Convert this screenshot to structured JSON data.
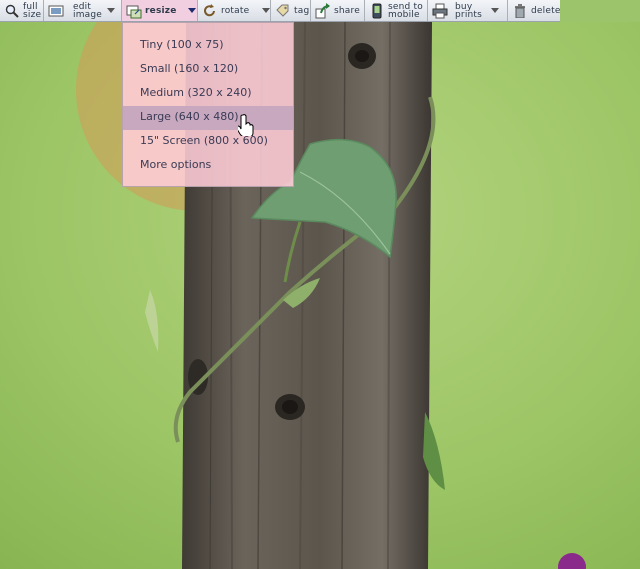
{
  "toolbar": {
    "full_size": [
      "full",
      "size"
    ],
    "edit_image": [
      "edit",
      "image"
    ],
    "resize": "resize",
    "rotate": "rotate",
    "tag": "tag",
    "share": "share",
    "send_to_mobile": [
      "send to",
      "mobile"
    ],
    "buy_prints": [
      "buy",
      "prints"
    ],
    "delete": "delete"
  },
  "resize_menu": {
    "items": [
      "Tiny (100 x 75)",
      "Small (160 x 120)",
      "Medium (320 x 240)",
      "Large (640 x 480)",
      "15\" Screen (800 x 600)",
      "More options"
    ],
    "highlighted": "Large (640 x 480)"
  },
  "colors": {
    "toolbar_bg": "#dfe3e9",
    "menu_bg": "#ffcdd7",
    "menu_highlight": "#c7a8bf",
    "active_tab": "#f2cfe0"
  },
  "icons": [
    "magnifier-icon",
    "edit-image-icon",
    "resize-icon",
    "rotate-icon",
    "tag-icon",
    "share-icon",
    "mobile-icon",
    "printer-icon",
    "trash-icon",
    "hand-cursor-icon"
  ]
}
